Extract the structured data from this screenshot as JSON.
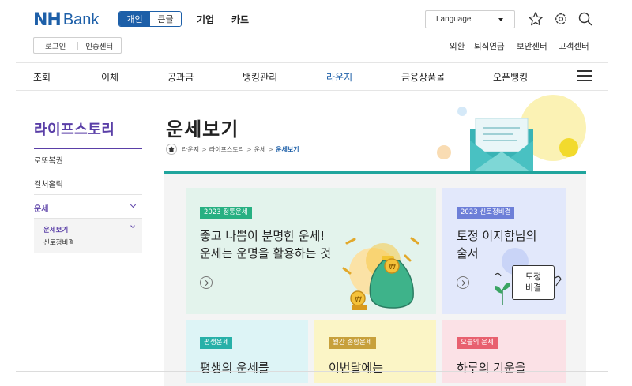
{
  "brand": {
    "logo_nh": "NH",
    "logo_bank": "Bank"
  },
  "header": {
    "mode_personal": "개인",
    "mode_large": "큰글",
    "link_corporate": "기업",
    "link_card": "카드",
    "language_label": "Language",
    "auth": {
      "login": "로그인",
      "cert_center": "인증센터"
    },
    "util_links": [
      "외환",
      "퇴직연금",
      "보안센터",
      "고객센터"
    ],
    "icons": [
      "star-icon",
      "settings-icon",
      "search-icon"
    ]
  },
  "nav": {
    "items": [
      "조회",
      "이체",
      "공과금",
      "뱅킹관리",
      "라운지",
      "금융상품몰",
      "오픈뱅킹"
    ],
    "active": "라운지"
  },
  "sidebar": {
    "title": "라이프스토리",
    "items": [
      "로또복권",
      "컬처홀릭",
      "운세"
    ],
    "sub_items": [
      "운세보기",
      "신토정비결"
    ]
  },
  "page": {
    "title": "운세보기",
    "breadcrumb": [
      "라운지",
      "라이프스토리",
      "운세",
      "운세보기"
    ]
  },
  "cards": [
    {
      "badge": "2023 정통운세",
      "line1": "좋고 나쁨이 분명한 운세!",
      "line2": "운세는 운명을 활용하는 것"
    },
    {
      "badge": "2023 신토정비결",
      "line1": "토정 이지함님의",
      "line2": "술서",
      "book_line1": "토정",
      "book_line2": "비결"
    },
    {
      "badge": "평생운세",
      "line1": "평생의 운세를"
    },
    {
      "badge": "월간 종합운세",
      "line1": "이번달에는"
    },
    {
      "badge": "오늘의 운세",
      "line1": "하루의 기운을"
    }
  ],
  "colors": {
    "brand_blue": "#1d5fa8",
    "sidebar_purple": "#5a3fa7",
    "accent_teal": "#20a59d",
    "card_green_bg": "#e3f3ec",
    "card_blue_bg": "#e2e8fb",
    "card_cyan_bg": "#ddf4f6",
    "card_yellow_bg": "#fbf5c6",
    "card_pink_bg": "#fbe1e6"
  }
}
